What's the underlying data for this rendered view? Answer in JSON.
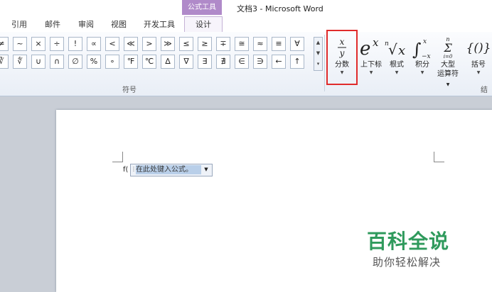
{
  "title_bar": {
    "context_group": "公式工具",
    "document_title": "文档3 - Microsoft Word"
  },
  "tabs": [
    {
      "label": "引用"
    },
    {
      "label": "邮件"
    },
    {
      "label": "审阅"
    },
    {
      "label": "视图"
    },
    {
      "label": "开发工具"
    },
    {
      "label": "设计"
    }
  ],
  "symbols": {
    "row1": [
      "≠",
      "~",
      "×",
      "÷",
      "!",
      "∝",
      "<",
      "≪",
      ">",
      "≫",
      "≤",
      "≥",
      "∓",
      "≅",
      "≈",
      "≡",
      "∀"
    ],
    "row2": [
      "∛",
      "∜",
      "∪",
      "∩",
      "∅",
      "%",
      "∘",
      "℉",
      "℃",
      "∆",
      "∇",
      "∃",
      "∄",
      "∈",
      "∋",
      "←",
      "↑"
    ],
    "group_label": "符号"
  },
  "structures": {
    "group_label": "结构",
    "tools": [
      {
        "name": "fraction",
        "symbol": "x/y",
        "label": "分数"
      },
      {
        "name": "script",
        "symbol": "eˣ",
        "label": "上下标"
      },
      {
        "name": "radical",
        "symbol": "ⁿ√x",
        "label": "根式"
      },
      {
        "name": "integral",
        "symbol": "∫",
        "label": "积分"
      },
      {
        "name": "large-operator",
        "symbol": "Σ",
        "label": "大型",
        "label2": "运算符"
      },
      {
        "name": "bracket",
        "symbol": "{()}",
        "label": "括号"
      }
    ]
  },
  "document": {
    "equation_prefix": "f(",
    "equation_placeholder": "在此处键入公式。"
  },
  "watermark": {
    "title": "百科全说",
    "subtitle": "助你轻松解决"
  },
  "colors": {
    "context_tab": "#b08ac9",
    "highlight_border": "#e02b2b",
    "watermark_green": "#2f9a5c",
    "placeholder_highlight": "#b9cfe9"
  }
}
